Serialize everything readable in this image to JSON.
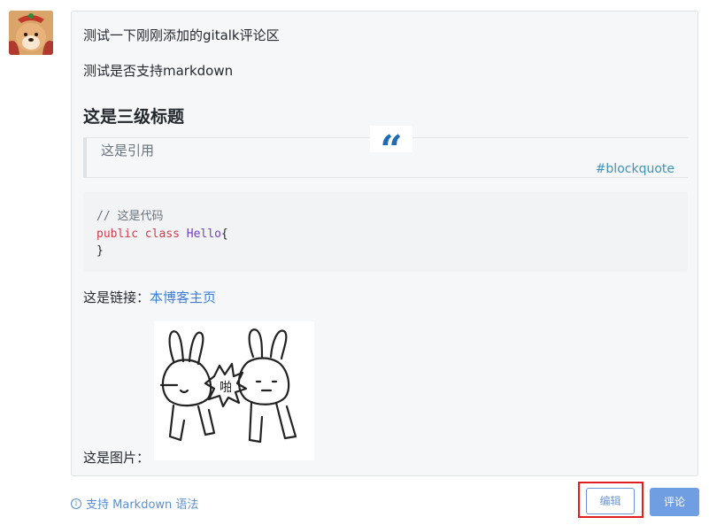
{
  "preview": {
    "line1": "测试一下刚刚添加的gitalk评论区",
    "line2": "测试是否支持markdown",
    "heading": "这是三级标题",
    "quote": {
      "text": "这是引用",
      "tag": "#blockquote",
      "mark": "“"
    },
    "code": {
      "comment": "// 这是代码",
      "keyword1": "public",
      "keyword2": "class",
      "classname": "Hello",
      "brace_open": "{",
      "brace_close": "}"
    },
    "link_prefix": "这是链接：",
    "link_text": "本博客主页",
    "image_prefix": "这是图片：",
    "image_bubble_text": "啪"
  },
  "footer": {
    "help_text": "支持 Markdown 语法",
    "help_icon": "info-icon",
    "edit_label": "编辑",
    "comment_label": "评论"
  },
  "colors": {
    "link": "#3f7fd8",
    "button_primary": "#6f9ee3",
    "highlight_box": "#e02020"
  }
}
